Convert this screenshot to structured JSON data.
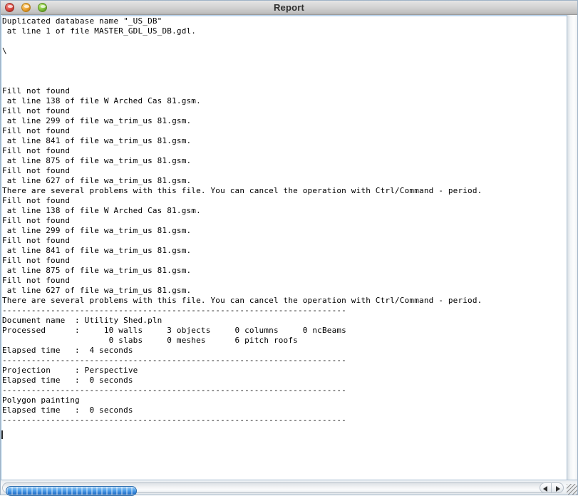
{
  "window": {
    "title": "Report",
    "controls": [
      {
        "name": "close",
        "label": "Close",
        "color": "#e2564e"
      },
      {
        "name": "minimize",
        "label": "Minimize",
        "color": "#f2ad3f"
      },
      {
        "name": "zoom",
        "label": "Zoom",
        "color": "#8ccc48"
      }
    ]
  },
  "report": {
    "lines": [
      "Duplicated database name \"_US_DB\"",
      " at line 1 of file MASTER_GDL_US_DB.gdl.",
      "",
      "\\",
      "",
      "",
      "",
      "Fill not found",
      " at line 138 of file W Arched Cas 81.gsm.",
      "Fill not found",
      " at line 299 of file wa_trim_us 81.gsm.",
      "Fill not found",
      " at line 841 of file wa_trim_us 81.gsm.",
      "Fill not found",
      " at line 875 of file wa_trim_us 81.gsm.",
      "Fill not found",
      " at line 627 of file wa_trim_us 81.gsm.",
      "There are several problems with this file. You can cancel the operation with Ctrl/Command - period.",
      "Fill not found",
      " at line 138 of file W Arched Cas 81.gsm.",
      "Fill not found",
      " at line 299 of file wa_trim_us 81.gsm.",
      "Fill not found",
      " at line 841 of file wa_trim_us 81.gsm.",
      "Fill not found",
      " at line 875 of file wa_trim_us 81.gsm.",
      "Fill not found",
      " at line 627 of file wa_trim_us 81.gsm.",
      "There are several problems with this file. You can cancel the operation with Ctrl/Command - period.",
      "-----------------------------------------------------------------------",
      "Document name  : Utility Shed.pln",
      "Processed      :     10 walls     3 objects     0 columns     0 ncBeams",
      "                      0 slabs     0 meshes      6 pitch roofs",
      "Elapsed time   :  4 seconds",
      "-----------------------------------------------------------------------",
      "Projection     : Perspective",
      "Elapsed time   :  0 seconds",
      "-----------------------------------------------------------------------",
      "Polygon painting",
      "Elapsed time   :  0 seconds",
      "-----------------------------------------------------------------------"
    ],
    "summary": {
      "document_name": "Utility Shed.pln",
      "walls": 10,
      "objects": 3,
      "columns": 0,
      "ncBeams": 0,
      "slabs": 0,
      "meshes": 0,
      "pitch_roofs": 6,
      "processing_elapsed_seconds": 4,
      "projection": "Perspective",
      "projection_elapsed_seconds": 0,
      "polygon_painting_elapsed_seconds": 0
    },
    "errors": {
      "duplicated_database_name": "_US_DB",
      "duplicated_database_file": "MASTER_GDL_US_DB.gdl",
      "duplicated_database_line": 1,
      "fill_not_found_entries": [
        {
          "line": 138,
          "file": "W Arched Cas 81.gsm"
        },
        {
          "line": 299,
          "file": "wa_trim_us 81.gsm"
        },
        {
          "line": 841,
          "file": "wa_trim_us 81.gsm"
        },
        {
          "line": 875,
          "file": "wa_trim_us 81.gsm"
        },
        {
          "line": 627,
          "file": "wa_trim_us 81.gsm"
        }
      ],
      "warning": "There are several problems with this file. You can cancel the operation with Ctrl/Command - period."
    }
  },
  "scrollbars": {
    "horizontal": {
      "thumb_percent": 24,
      "left_arrow": "◀",
      "right_arrow": "▶"
    },
    "vertical": {
      "thumb_percent": 100
    }
  },
  "colors": {
    "titlebar_text": "#30302f",
    "text": "#000000",
    "background": "#ffffff",
    "scrollbar_accent": "#2f7fd6",
    "focus_ring": "#9cc0e0"
  }
}
